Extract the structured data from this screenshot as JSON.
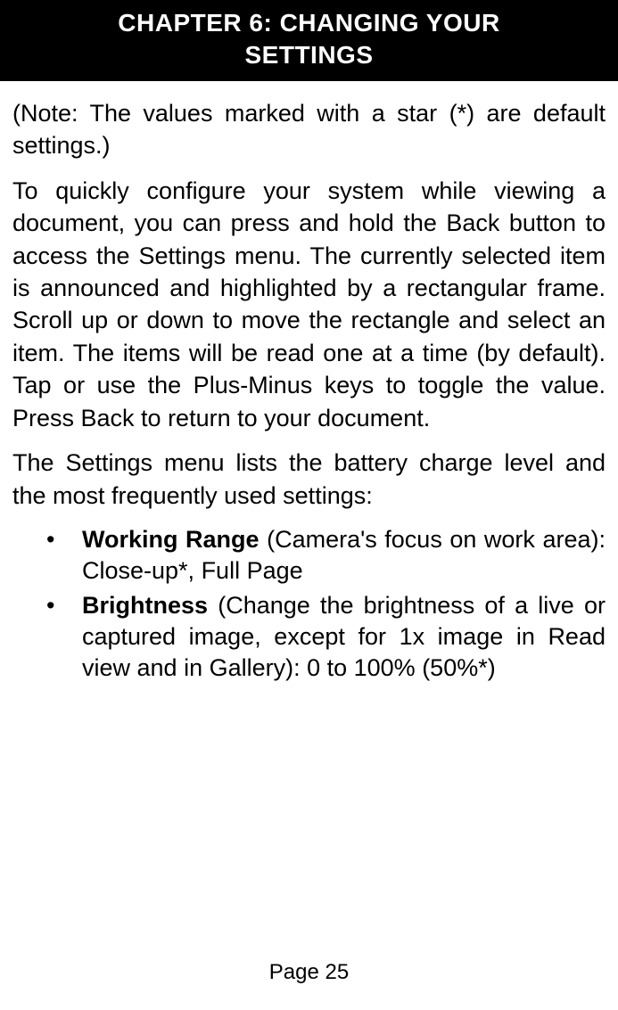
{
  "chapter": {
    "title_line1": "CHAPTER 6: CHANGING YOUR",
    "title_line2": "SETTINGS"
  },
  "note": "(Note: The values marked with a star (*) are default settings.)",
  "intro_paragraph": "To quickly configure your system while viewing a document, you can press and hold the Back button to access the Settings menu. The currently selected item is announced and highlighted by a rectangular frame. Scroll up or down to move the rectangle and select an item. The items will be read one at a time (by default). Tap or use the Plus-Minus keys to toggle the value. Press Back to return to your document.",
  "list_intro": "The Settings menu lists the battery charge level and the most frequently used settings:",
  "settings": [
    {
      "name": "Working Range",
      "description": " (Camera's focus on work area): Close-up*, Full Page"
    },
    {
      "name": "Brightness",
      "description": " (Change the brightness of a live or captured image, except for 1x image in Read view and in Gallery): 0 to 100% (50%*)"
    }
  ],
  "page_number": "Page 25"
}
